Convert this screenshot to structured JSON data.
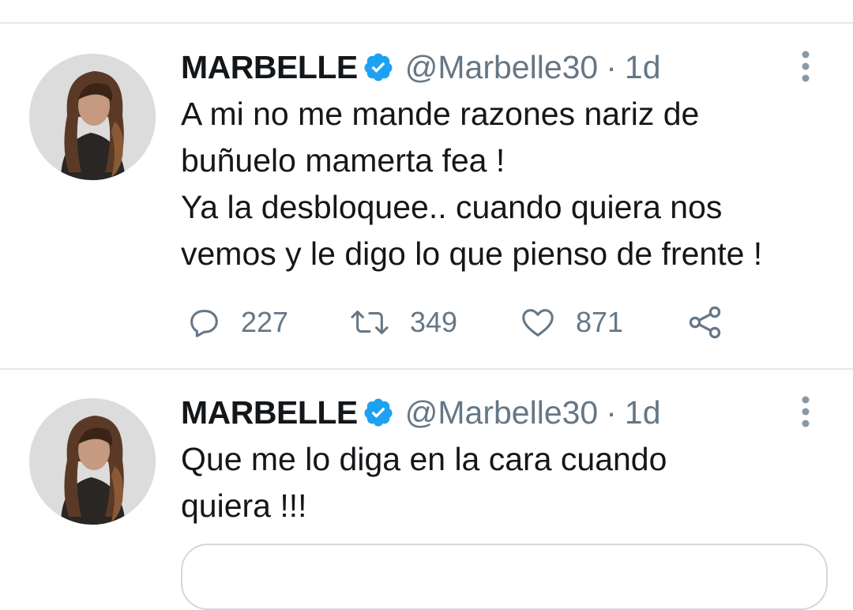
{
  "tweets": [
    {
      "author_name": "MARBELLE",
      "handle": "@Marbelle30",
      "separator": "·",
      "time": "1d",
      "text_lines": [
        "A mi no me mande razones nariz de",
        "buñuelo mamerta fea !",
        "Ya la desbloquee.. cuando quiera nos",
        "vemos y le digo lo que pienso de frente !"
      ],
      "replies": "227",
      "retweets": "349",
      "likes": "871",
      "icons": {
        "verified": "verified-badge-icon",
        "more": "more-options-icon",
        "reply": "reply-icon",
        "retweet": "retweet-icon",
        "like": "heart-icon",
        "share": "share-icon"
      }
    },
    {
      "author_name": "MARBELLE",
      "handle": "@Marbelle30",
      "separator": "·",
      "time": "1d",
      "text_lines": [
        "Que me lo diga en la cara cuando",
        "quiera !!!"
      ]
    }
  ],
  "colors": {
    "text": "#14171a",
    "secondary": "#657786",
    "verified": "#1da1f2",
    "divider": "#e1e8ed"
  }
}
